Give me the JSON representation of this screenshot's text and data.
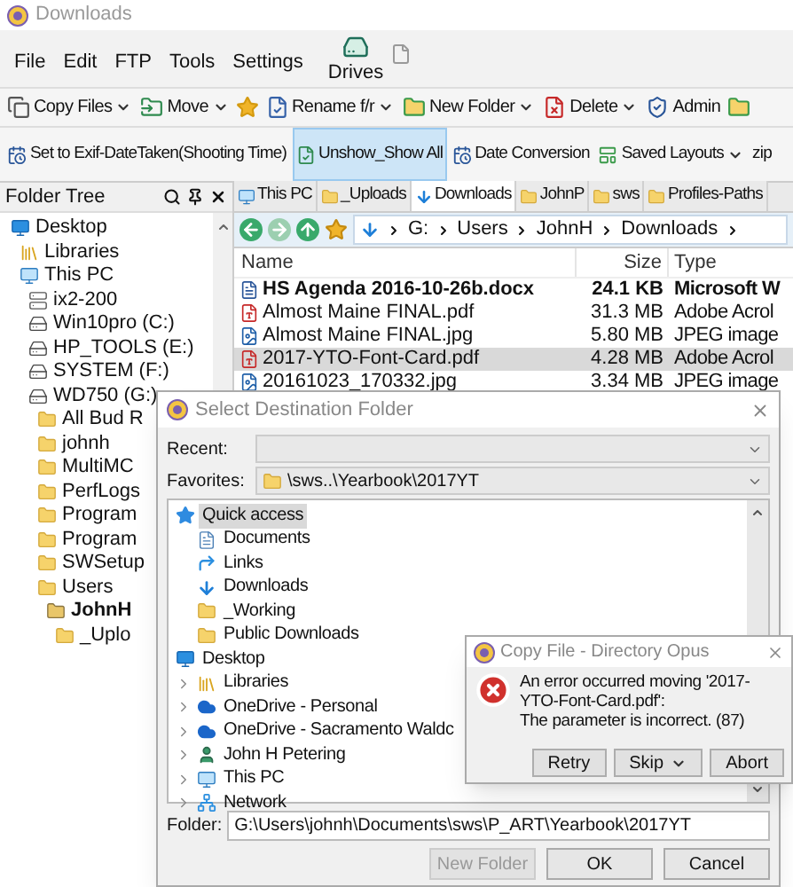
{
  "window": {
    "title": "Downloads"
  },
  "menu": [
    "File",
    "Edit",
    "FTP",
    "Tools",
    "Settings"
  ],
  "drives_button": {
    "label": "Drives"
  },
  "toolbar_1": [
    {
      "kind": "button",
      "label": "Copy Files",
      "dropdown": true
    },
    {
      "kind": "button",
      "label": "Move",
      "dropdown": true
    },
    {
      "kind": "icon-button",
      "dropdown": false
    },
    {
      "kind": "button",
      "label": "Rename f/r",
      "dropdown": true
    },
    {
      "kind": "button",
      "label": "New Folder",
      "dropdown": true
    },
    {
      "kind": "button",
      "label": "Delete",
      "dropdown": true
    },
    {
      "kind": "button",
      "label": "Admin",
      "dropdown": false
    },
    {
      "kind": "icon-button",
      "dropdown": false
    }
  ],
  "toolbar_2": [
    {
      "label": "Set to Exif-DateTaken(Shooting Time)",
      "selected": false,
      "dropdown": false
    },
    {
      "label": "Unshow_Show All",
      "selected": true,
      "dropdown": false
    },
    {
      "label": "Date Conversion",
      "selected": false,
      "dropdown": false
    },
    {
      "label": "Saved Layouts",
      "selected": false,
      "dropdown": true
    },
    {
      "label": "zip",
      "selected": false,
      "dropdown": false
    }
  ],
  "folder_tree": {
    "title": "Folder Tree",
    "items": [
      {
        "label": "Desktop",
        "kind": "desktop",
        "selected": false,
        "children": [
          {
            "label": "Libraries",
            "kind": "libraries",
            "selected": false
          },
          {
            "label": "This PC",
            "kind": "pc",
            "selected": false,
            "children": [
              {
                "label": "ix2-200",
                "kind": "nas",
                "selected": false
              },
              {
                "label": "Win10pro (C:)",
                "kind": "drive",
                "selected": false
              },
              {
                "label": "HP_TOOLS (E:)",
                "kind": "drive",
                "selected": false
              },
              {
                "label": "SYSTEM (F:)",
                "kind": "drive",
                "selected": false
              },
              {
                "label": "WD750 (G:)",
                "kind": "drive",
                "selected": false,
                "children": [
                  {
                    "label": "All Bud R",
                    "kind": "folder",
                    "selected": false
                  },
                  {
                    "label": "johnh",
                    "kind": "folder",
                    "selected": false
                  },
                  {
                    "label": "MultiMC",
                    "kind": "folder",
                    "selected": false
                  },
                  {
                    "label": "PerfLogs",
                    "kind": "folder",
                    "selected": false
                  },
                  {
                    "label": "Program",
                    "kind": "folder",
                    "selected": false
                  },
                  {
                    "label": "Program",
                    "kind": "folder",
                    "selected": false
                  },
                  {
                    "label": "SWSetup",
                    "kind": "folder",
                    "selected": false
                  },
                  {
                    "label": "Users",
                    "kind": "folder",
                    "selected": false,
                    "children": [
                      {
                        "label": "JohnH",
                        "kind": "user-folder",
                        "selected": true,
                        "children": [
                          {
                            "label": "_Uplo",
                            "kind": "folder",
                            "selected": false
                          }
                        ]
                      }
                    ]
                  }
                ]
              }
            ]
          }
        ]
      }
    ]
  },
  "tabs": [
    {
      "label": "This PC",
      "kind": "pc",
      "selected": false
    },
    {
      "label": "_Uploads",
      "kind": "folder",
      "selected": false
    },
    {
      "label": "Downloads",
      "kind": "download",
      "selected": true
    },
    {
      "label": "JohnP",
      "kind": "folder",
      "selected": false
    },
    {
      "label": "sws",
      "kind": "folder",
      "selected": false
    },
    {
      "label": "Profiles-Paths",
      "kind": "folder",
      "selected": false
    }
  ],
  "address_bar": {
    "path": [
      "G:",
      "Users",
      "JohnH",
      "Downloads"
    ]
  },
  "file_list": {
    "columns": [
      "Name",
      "Size",
      "Type"
    ],
    "rows": [
      {
        "name": "HS Agenda 2016-10-26b.docx",
        "size": "24.1 KB",
        "type": "Microsoft W",
        "kind": "doc",
        "new": true,
        "selected": false
      },
      {
        "name": "Almost Maine FINAL.pdf",
        "size": "31.3 MB",
        "type": "Adobe Acrol",
        "kind": "pdf",
        "new": false,
        "selected": false
      },
      {
        "name": "Almost Maine FINAL.jpg",
        "size": "5.80 MB",
        "type": "JPEG image",
        "kind": "image",
        "new": false,
        "selected": false
      },
      {
        "name": "2017-YTO-Font-Card.pdf",
        "size": "4.28 MB",
        "type": "Adobe Acrol",
        "kind": "pdf",
        "new": false,
        "selected": true
      },
      {
        "name": "20161023_170332.jpg",
        "size": "3.34 MB",
        "type": "JPEG image",
        "kind": "image",
        "new": false,
        "selected": false
      }
    ]
  },
  "select_dialog": {
    "title": "Select Destination Folder",
    "recent": {
      "label": "Recent:"
    },
    "favorites": {
      "label": "Favorites:",
      "value": "\\sws..\\Yearbook\\2017YT"
    },
    "tree": [
      {
        "label": "Quick access",
        "kind": "star",
        "selected": true,
        "expandable": false,
        "children": [
          {
            "label": "Documents",
            "kind": "document",
            "selected": false,
            "expandable": false
          },
          {
            "label": "Links",
            "kind": "link",
            "selected": false,
            "expandable": false
          },
          {
            "label": "Downloads",
            "kind": "download",
            "selected": false,
            "expandable": false
          },
          {
            "label": "_Working",
            "kind": "folder",
            "selected": false,
            "expandable": false
          },
          {
            "label": "Public Downloads",
            "kind": "folder",
            "selected": false,
            "expandable": false
          }
        ]
      },
      {
        "label": "Desktop",
        "kind": "desktop",
        "selected": false,
        "expandable": false,
        "children": [
          {
            "label": "Libraries",
            "kind": "libraries",
            "selected": false,
            "expandable": true
          },
          {
            "label": "OneDrive - Personal",
            "kind": "cloud",
            "selected": false,
            "expandable": true
          },
          {
            "label": "OneDrive - Sacramento Waldc",
            "kind": "cloud",
            "selected": false,
            "expandable": true
          },
          {
            "label": "John H Petering",
            "kind": "user",
            "selected": false,
            "expandable": true
          },
          {
            "label": "This PC",
            "kind": "pc",
            "selected": false,
            "expandable": true
          },
          {
            "label": "Network",
            "kind": "network",
            "selected": false,
            "expandable": true
          }
        ]
      }
    ],
    "folder_field": {
      "label": "Folder:",
      "value": "G:\\Users\\johnh\\Documents\\sws\\P_ART\\Yearbook\\2017YT"
    },
    "buttons": [
      {
        "label": "New Folder",
        "disabled": true
      },
      {
        "label": "OK",
        "disabled": false
      },
      {
        "label": "Cancel",
        "disabled": false
      }
    ]
  },
  "error_dialog": {
    "title": "Copy File - Directory Opus",
    "message_lines": [
      "An error occurred moving '2017-YTO-Font-Card.pdf':",
      "The parameter is incorrect. (87)"
    ],
    "buttons": [
      {
        "label": "Retry",
        "dropdown": false
      },
      {
        "label": "Skip",
        "dropdown": true
      },
      {
        "label": "Abort",
        "dropdown": false
      }
    ]
  }
}
